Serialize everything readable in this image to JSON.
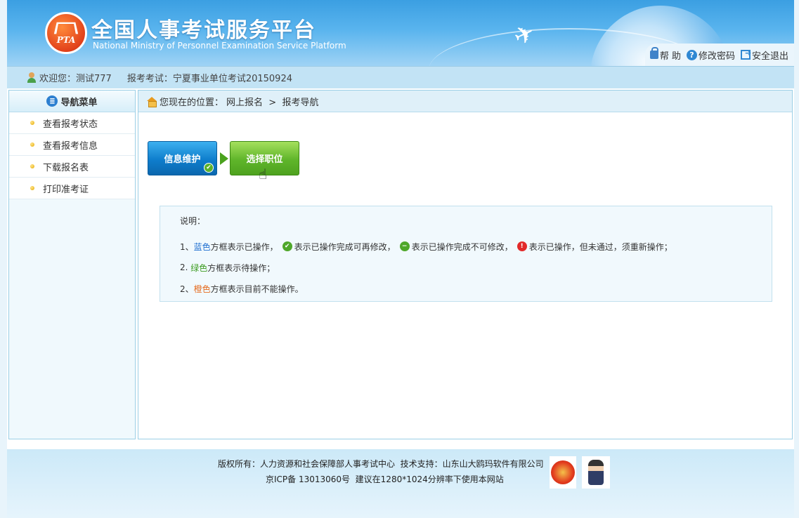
{
  "header": {
    "logo_text": "PTA",
    "title": "全国人事考试服务平台",
    "subtitle": "National Ministry of Personnel Examination Service Platform",
    "links": [
      {
        "icon": "lock-icon",
        "label": "帮 助"
      },
      {
        "icon": "help-icon",
        "label": "修改密码"
      },
      {
        "icon": "exit-icon",
        "label": "安全退出"
      }
    ]
  },
  "welcome": {
    "greeting": "欢迎您：测试777",
    "exam": "报考考试：宁夏事业单位考试20150924"
  },
  "sidebar": {
    "title": "导航菜单",
    "items": [
      {
        "label": "查看报考状态"
      },
      {
        "label": "查看报考信息"
      },
      {
        "label": "下载报名表"
      },
      {
        "label": "打印准考证"
      }
    ]
  },
  "breadcrumb": {
    "prefix": "您现在的位置：",
    "path": "网上报名  >  报考导航"
  },
  "steps": [
    {
      "label": "信息维护",
      "color": "#0e7dcc",
      "status": "done-editable"
    },
    {
      "label": "选择职位",
      "color": "#5fb52a",
      "status": "pending"
    }
  ],
  "note": {
    "title": "说明：",
    "line1": {
      "prefix": "1、",
      "color_word": "蓝色",
      "text": "方框表示已操作，",
      "check_text": "表示已操作完成可再修改，",
      "minus_text": "表示已操作完成不可修改，",
      "error_text": "表示已操作，但未通过，须重新操作；"
    },
    "line2": {
      "prefix": "2. ",
      "color_word": "绿色",
      "text": "方框表示待操作；"
    },
    "line3": {
      "prefix": "2、",
      "color_word": "橙色",
      "text": "方框表示目前不能操作。"
    },
    "colors": {
      "blue": "#1f6fd0",
      "green": "#3d9c22",
      "orange": "#e56b1f"
    }
  },
  "footer": {
    "line1": "版权所有：人力资源和社会保障部人事考试中心  技术支持：山东山大鸥玛软件有限公司",
    "line2": "京ICP备 13013060号  建议在1280*1024分辨率下使用本网站"
  }
}
